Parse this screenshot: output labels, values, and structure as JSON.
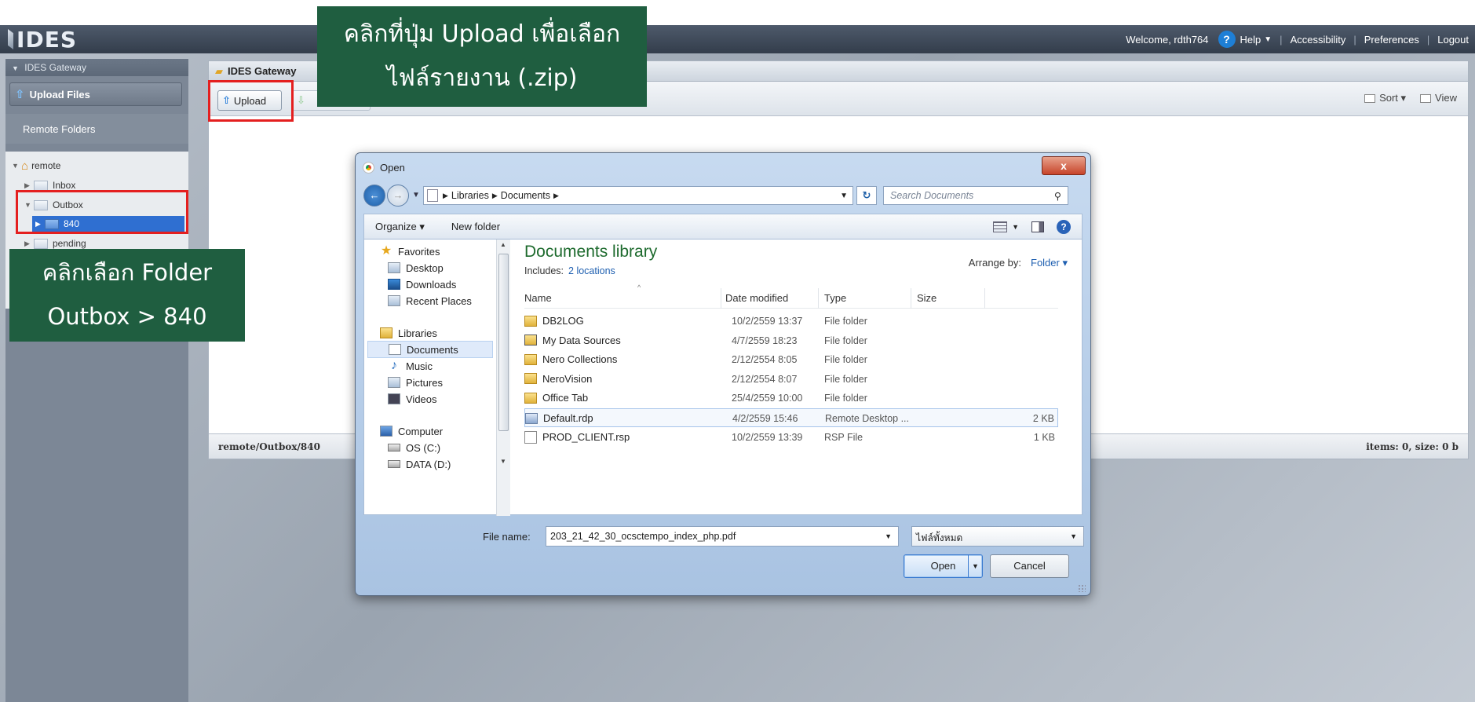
{
  "app": {
    "logo_text": "IDES",
    "welcome": "Welcome, rdth764",
    "help_label": "Help",
    "accessibility_label": "Accessibility",
    "preferences_label": "Preferences",
    "logout_label": "Logout"
  },
  "sidebar": {
    "section_title": "IDES Gateway",
    "upload_files_label": "Upload Files",
    "remote_folders_title": "Remote Folders",
    "tree": {
      "root": "remote",
      "inbox": "Inbox",
      "outbox": "Outbox",
      "folder_840": "840",
      "pending": "pending"
    }
  },
  "main": {
    "header_title": "IDES Gateway",
    "upload_label": "Upload",
    "sort_label": "Sort",
    "view_label": "View",
    "footer_path": "remote/Outbox/840",
    "footer_status": "items: 0, size: 0 b"
  },
  "callouts": {
    "upload_line1": "คลิกที่ปุ่ม Upload เพื่อเลือก",
    "upload_line2": "ไฟล์รายงาน (.zip)",
    "folder_line1": "คลิกเลือก Folder",
    "folder_line2": "Outbox > 840"
  },
  "dialog": {
    "title": "Open",
    "close_label": "x",
    "address": [
      "Libraries",
      "Documents"
    ],
    "search_placeholder": "Search Documents",
    "toolbar": {
      "organize_label": "Organize ▾",
      "new_folder_label": "New folder"
    },
    "nav_pane": {
      "favorites": "Favorites",
      "desktop": "Desktop",
      "downloads": "Downloads",
      "recent_places": "Recent Places",
      "libraries": "Libraries",
      "documents": "Documents",
      "music": "Music",
      "pictures": "Pictures",
      "videos": "Videos",
      "computer": "Computer",
      "os_c": "OS (C:)",
      "data_d": "DATA (D:)"
    },
    "library": {
      "title": "Documents library",
      "includes_label": "Includes:",
      "includes_link": "2 locations",
      "arrange_label": "Arrange by:",
      "arrange_value": "Folder ▾"
    },
    "columns": {
      "name": "Name",
      "date_modified": "Date modified",
      "type": "Type",
      "size": "Size"
    },
    "files": [
      {
        "name": "DB2LOG",
        "date": "10/2/2559 13:37",
        "type": "File folder",
        "size": "",
        "icon": "folder"
      },
      {
        "name": "My Data Sources",
        "date": "4/7/2559 18:23",
        "type": "File folder",
        "size": "",
        "icon": "ds"
      },
      {
        "name": "Nero Collections",
        "date": "2/12/2554 8:05",
        "type": "File folder",
        "size": "",
        "icon": "folder"
      },
      {
        "name": "NeroVision",
        "date": "2/12/2554 8:07",
        "type": "File folder",
        "size": "",
        "icon": "folder"
      },
      {
        "name": "Office Tab",
        "date": "25/4/2559 10:00",
        "type": "File folder",
        "size": "",
        "icon": "folder"
      },
      {
        "name": "Default.rdp",
        "date": "4/2/2559 15:46",
        "type": "Remote Desktop ...",
        "size": "2 KB",
        "icon": "rdp"
      },
      {
        "name": "PROD_CLIENT.rsp",
        "date": "10/2/2559 13:39",
        "type": "RSP File",
        "size": "1 KB",
        "icon": "doc"
      }
    ],
    "file_name_label": "File name:",
    "file_name_value": "203_21_42_30_ocsctempo_index_php.pdf",
    "file_type_value": "ไฟล์ทั้งหมด",
    "open_label": "Open",
    "cancel_label": "Cancel"
  }
}
